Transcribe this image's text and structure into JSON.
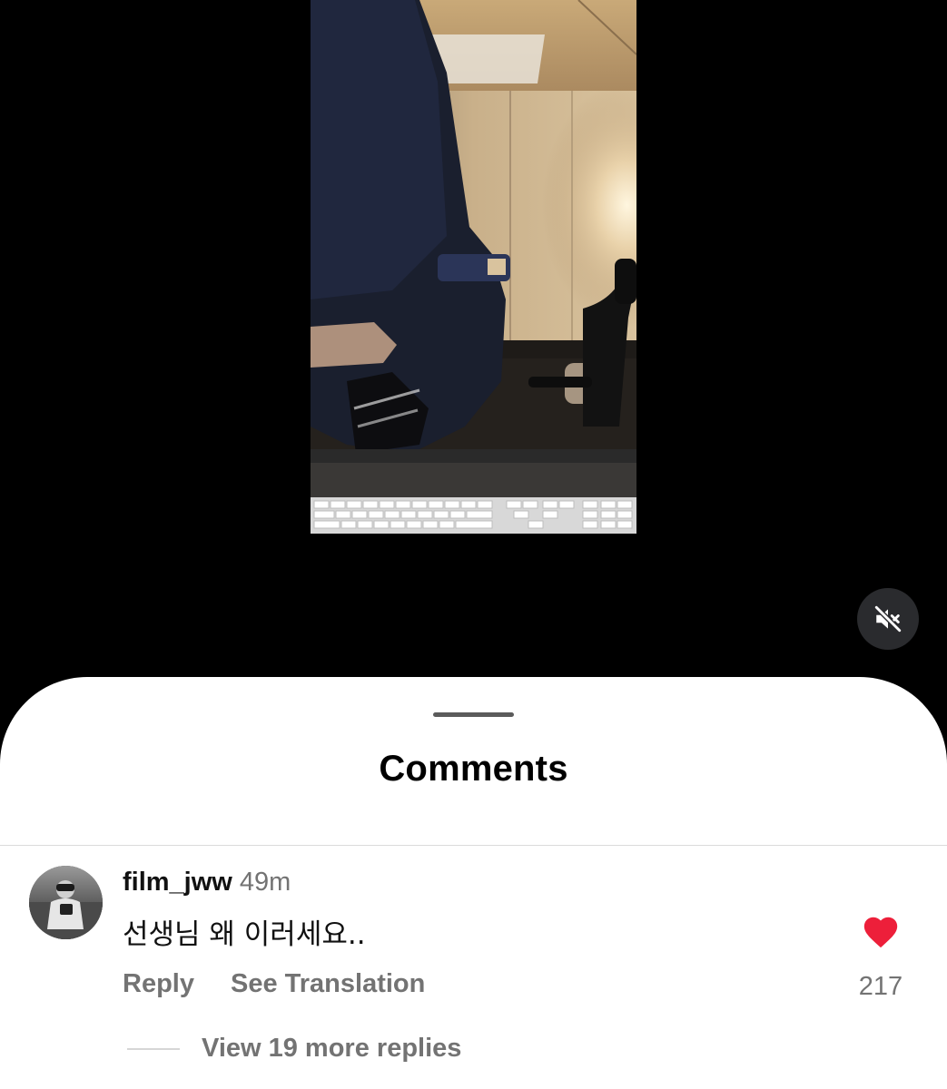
{
  "video": {
    "mute_icon": "speaker-muted-icon"
  },
  "comments_sheet": {
    "title": "Comments",
    "comments": [
      {
        "username": "film_jww",
        "time": "49m",
        "text": "선생님 왜 이러세요..",
        "reply_label": "Reply",
        "translate_label": "See Translation",
        "like_count": "217",
        "liked": true,
        "like_color": "#ed1f3a",
        "view_replies_label": "View 19 more replies"
      }
    ]
  }
}
